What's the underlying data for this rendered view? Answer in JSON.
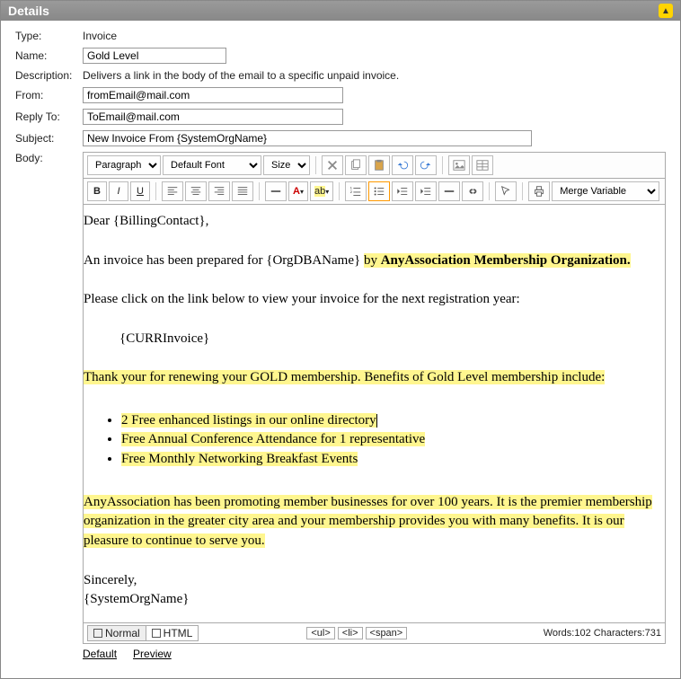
{
  "header": {
    "title": "Details",
    "collapse_glyph": "▲"
  },
  "labels": {
    "type": "Type:",
    "name": "Name:",
    "description": "Description:",
    "from": "From:",
    "replyTo": "Reply To:",
    "subject": "Subject:",
    "body": "Body:"
  },
  "values": {
    "type": "Invoice",
    "name": "Gold Level",
    "description": "Delivers a link in the body of the email to a specific unpaid invoice.",
    "from": "fromEmail@mail.com",
    "replyTo": "ToEmail@mail.com",
    "subject": "New Invoice From {SystemOrgName}"
  },
  "toolbar": {
    "paragraph": "Paragraph",
    "font": "Default Font",
    "size": "Size",
    "merge": "Merge Variable"
  },
  "body_content": {
    "greeting": "Dear {BillingContact},",
    "line1a": "An invoice has been prepared for {OrgDBAName} ",
    "line1b": "by ",
    "line1c": "AnyAssociation Membership Organization.",
    "line2": "Please click on the link below to view your invoice for the next registration year:",
    "curr": "{CURRInvoice}",
    "thank": "Thank your for renewing your GOLD membership.  Benefits of Gold Level membership include:",
    "bullets": [
      " 2 Free enhanced listings in our online directory",
      "Free Annual Conference Attendance for 1 representative",
      "Free Monthly Networking Breakfast Events"
    ],
    "closing": "AnyAssociation has been promoting member businesses for over 100 years.  It is the premier membership organization in the greater city area and your membership provides you with many benefits.  It is our pleasure to continue to serve you.",
    "signoff1": "Sincerely,",
    "signoff2": "{SystemOrgName}"
  },
  "footer": {
    "tab_normal": "Normal",
    "tab_html": "HTML",
    "path": [
      "<ul>",
      "<li>",
      "<span>"
    ],
    "words_label": "Words:",
    "words": "102",
    "chars_label": "Characters:",
    "chars": "731"
  },
  "links": {
    "default": "Default",
    "preview": "Preview"
  }
}
